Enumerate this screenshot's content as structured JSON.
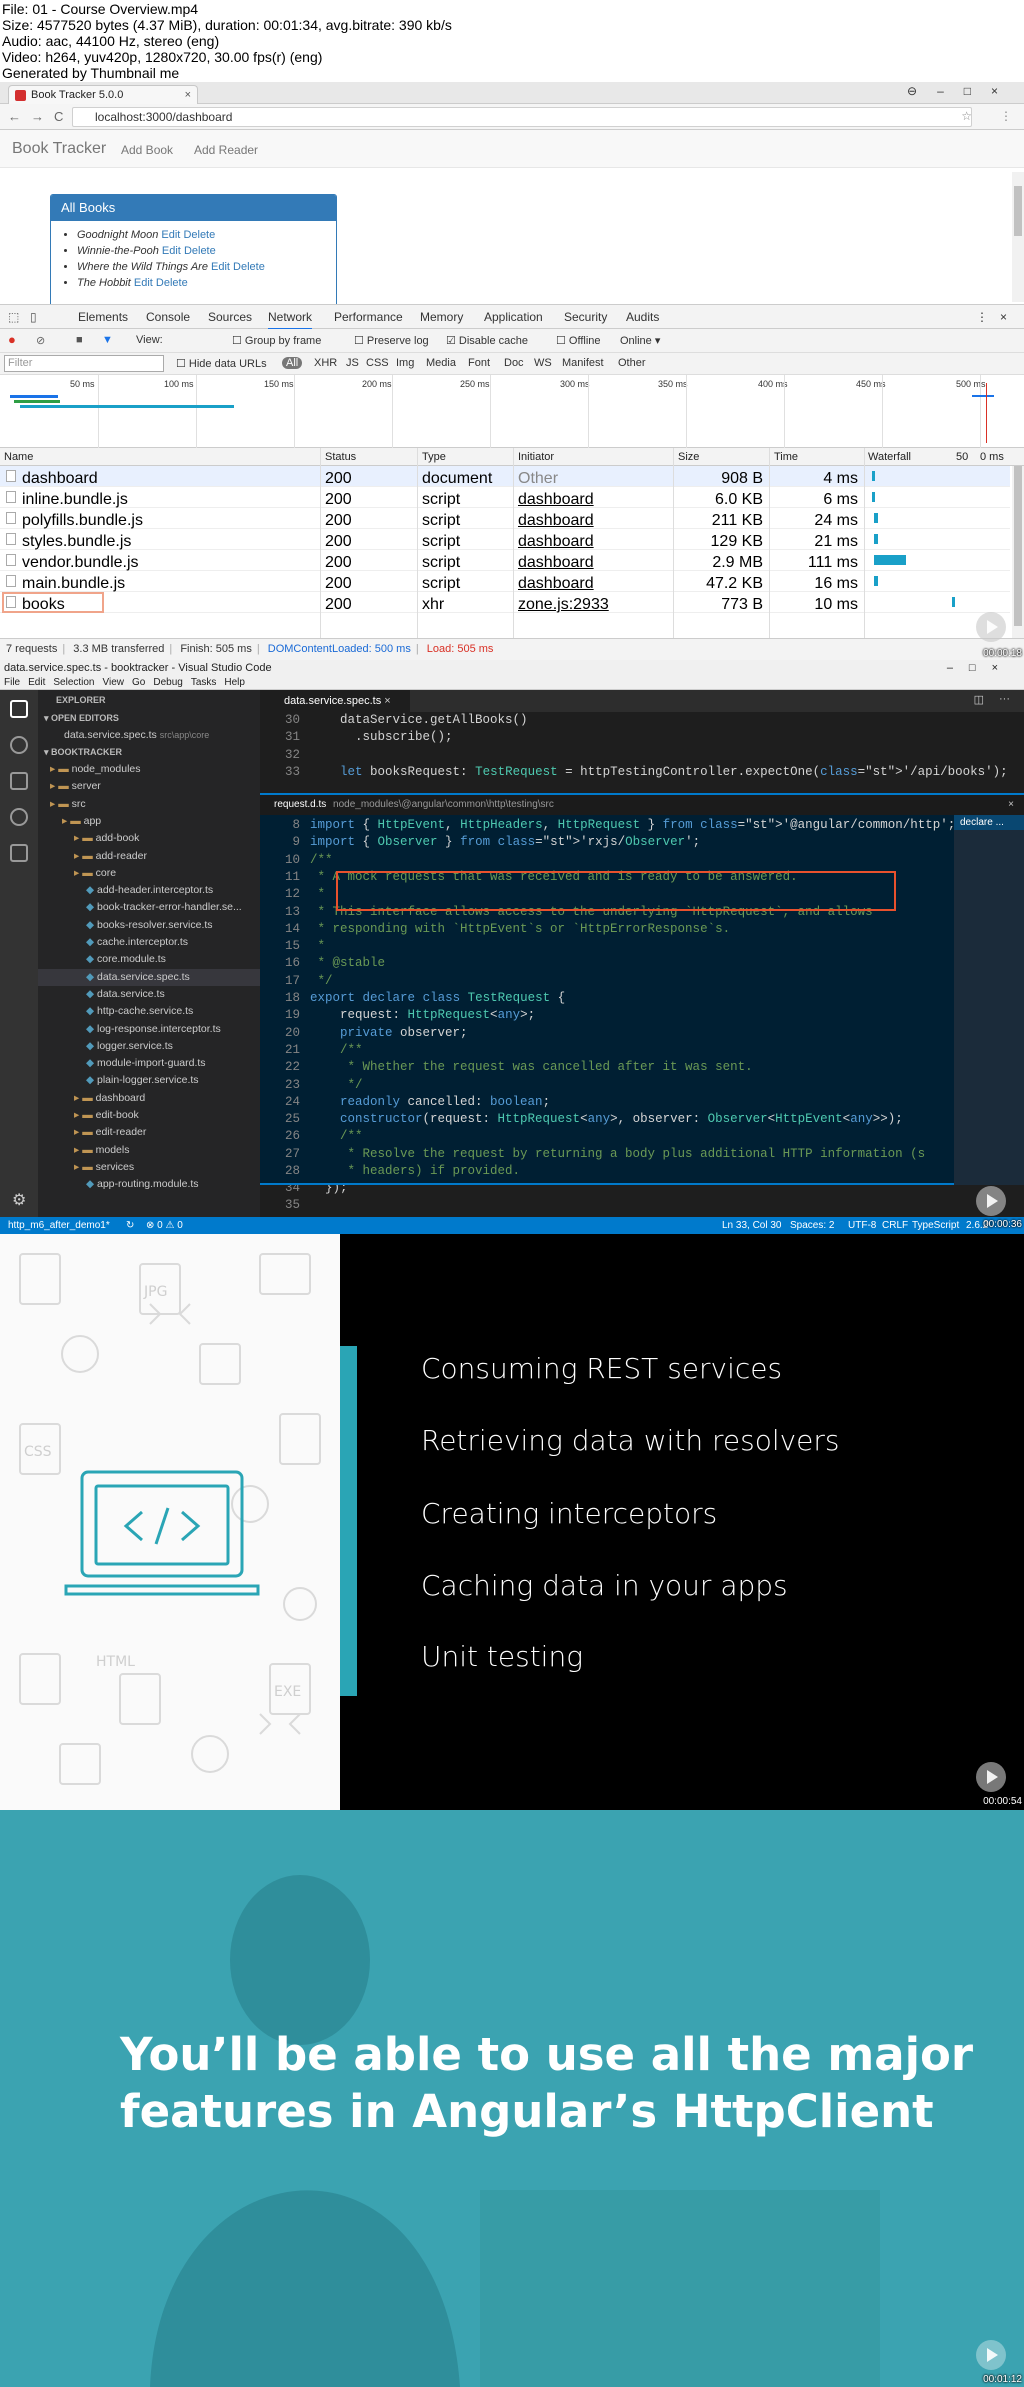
{
  "info": {
    "file": "File: 01 - Course Overview.mp4",
    "size": "Size: 4577520 bytes (4.37 MiB), duration: 00:01:34, avg.bitrate: 390 kb/s",
    "audio": "Audio: aac, 44100 Hz, stereo (eng)",
    "video": "Video: h264, yuv420p, 1280x720, 30.00 fps(r) (eng)",
    "generated": "Generated by Thumbnail me"
  },
  "frame1": {
    "tab_title": "Book Tracker 5.0.0",
    "url": "localhost:3000/dashboard",
    "brand": "Book Tracker",
    "nav_add_book": "Add Book",
    "nav_add_reader": "Add Reader",
    "panel_title": "All Books",
    "books": [
      {
        "title": "Goodnight Moon",
        "edit": "Edit",
        "del": "Delete"
      },
      {
        "title": "Winnie-the-Pooh",
        "edit": "Edit",
        "del": "Delete"
      },
      {
        "title": "Where the Wild Things Are",
        "edit": "Edit",
        "del": "Delete"
      },
      {
        "title": "The Hobbit",
        "edit": "Edit",
        "del": "Delete"
      }
    ],
    "devtools_tabs": [
      "Elements",
      "Console",
      "Sources",
      "Network",
      "Performance",
      "Memory",
      "Application",
      "Security",
      "Audits"
    ],
    "toolbar": {
      "view": "View:",
      "group": "Group by frame",
      "preserve": "Preserve log",
      "disable": "Disable cache",
      "offline": "Offline",
      "online": "Online"
    },
    "filter": {
      "placeholder": "Filter",
      "hide": "Hide data URLs",
      "types": [
        "All",
        "XHR",
        "JS",
        "CSS",
        "Img",
        "Media",
        "Font",
        "Doc",
        "WS",
        "Manifest",
        "Other"
      ]
    },
    "ticks": [
      "50 ms",
      "100 ms",
      "150 ms",
      "200 ms",
      "250 ms",
      "300 ms",
      "350 ms",
      "400 ms",
      "450 ms",
      "500 ms"
    ],
    "columns": [
      "Name",
      "Status",
      "Type",
      "Initiator",
      "Size",
      "Time",
      "Waterfall"
    ],
    "waterfall_extra": "50",
    "waterfall_extra2": "0 ms",
    "rows": [
      {
        "name": "dashboard",
        "status": "200",
        "type": "document",
        "initiator": "Other",
        "size": "908 B",
        "time": "4 ms"
      },
      {
        "name": "inline.bundle.js",
        "status": "200",
        "type": "script",
        "initiator": "dashboard",
        "size": "6.0 KB",
        "time": "6 ms"
      },
      {
        "name": "polyfills.bundle.js",
        "status": "200",
        "type": "script",
        "initiator": "dashboard",
        "size": "211 KB",
        "time": "24 ms"
      },
      {
        "name": "styles.bundle.js",
        "status": "200",
        "type": "script",
        "initiator": "dashboard",
        "size": "129 KB",
        "time": "21 ms"
      },
      {
        "name": "vendor.bundle.js",
        "status": "200",
        "type": "script",
        "initiator": "dashboard",
        "size": "2.9 MB",
        "time": "111 ms"
      },
      {
        "name": "main.bundle.js",
        "status": "200",
        "type": "script",
        "initiator": "dashboard",
        "size": "47.2 KB",
        "time": "16 ms"
      },
      {
        "name": "books",
        "status": "200",
        "type": "xhr",
        "initiator": "zone.js:2933",
        "size": "773 B",
        "time": "10 ms"
      }
    ],
    "status_bar": {
      "requests": "7 requests",
      "transferred": "3.3 MB transferred",
      "finish": "Finish: 505 ms",
      "dcl": "DOMContentLoaded: 500 ms",
      "load": "Load: 505 ms"
    },
    "timestamp": "00:00:18",
    "colors": {
      "panel": "#337ab7",
      "dcl": "#1a6ad6",
      "load": "#d93025"
    }
  },
  "frame2": {
    "title": "data.service.spec.ts - booktracker - Visual Studio Code",
    "menu": [
      "File",
      "Edit",
      "Selection",
      "View",
      "Go",
      "Debug",
      "Tasks",
      "Help"
    ],
    "explorer_title": "EXPLORER",
    "open_editors": "OPEN EDITORS",
    "open_file": "data.service.spec.ts",
    "open_file_path": "src\\app\\core",
    "project": "BOOKTRACKER",
    "tree": [
      {
        "label": "node_modules",
        "indent": 1,
        "kind": "folder"
      },
      {
        "label": "server",
        "indent": 1,
        "kind": "folder"
      },
      {
        "label": "src",
        "indent": 1,
        "kind": "folder"
      },
      {
        "label": "app",
        "indent": 2,
        "kind": "folder"
      },
      {
        "label": "add-book",
        "indent": 3,
        "kind": "folder"
      },
      {
        "label": "add-reader",
        "indent": 3,
        "kind": "folder"
      },
      {
        "label": "core",
        "indent": 3,
        "kind": "folder"
      },
      {
        "label": "add-header.interceptor.ts",
        "indent": 4,
        "kind": "file"
      },
      {
        "label": "book-tracker-error-handler.se...",
        "indent": 4,
        "kind": "file"
      },
      {
        "label": "books-resolver.service.ts",
        "indent": 4,
        "kind": "file"
      },
      {
        "label": "cache.interceptor.ts",
        "indent": 4,
        "kind": "file"
      },
      {
        "label": "core.module.ts",
        "indent": 4,
        "kind": "file"
      },
      {
        "label": "data.service.spec.ts",
        "indent": 4,
        "kind": "file"
      },
      {
        "label": "data.service.ts",
        "indent": 4,
        "kind": "file"
      },
      {
        "label": "http-cache.service.ts",
        "indent": 4,
        "kind": "file"
      },
      {
        "label": "log-response.interceptor.ts",
        "indent": 4,
        "kind": "file"
      },
      {
        "label": "logger.service.ts",
        "indent": 4,
        "kind": "file"
      },
      {
        "label": "module-import-guard.ts",
        "indent": 4,
        "kind": "file"
      },
      {
        "label": "plain-logger.service.ts",
        "indent": 4,
        "kind": "file"
      },
      {
        "label": "dashboard",
        "indent": 3,
        "kind": "folder"
      },
      {
        "label": "edit-book",
        "indent": 3,
        "kind": "folder"
      },
      {
        "label": "edit-reader",
        "indent": 3,
        "kind": "folder"
      },
      {
        "label": "models",
        "indent": 3,
        "kind": "folder"
      },
      {
        "label": "services",
        "indent": 3,
        "kind": "folder"
      },
      {
        "label": "app-routing.module.ts",
        "indent": 4,
        "kind": "file"
      }
    ],
    "tab": "data.service.spec.ts",
    "top_code": [
      {
        "n": "30",
        "t": "    dataService.getAllBooks()"
      },
      {
        "n": "31",
        "t": "      .subscribe();"
      },
      {
        "n": "32",
        "t": ""
      },
      {
        "n": "33",
        "t": "    let booksRequest: TestRequest = httpTestingController.expectOne('/api/books');"
      }
    ],
    "peek_file": "request.d.ts",
    "peek_path": "node_modules\\@angular\\common\\http\\testing\\src",
    "peek_side": "declare ...",
    "peek_code": [
      {
        "n": "8",
        "t": "import { HttpEvent, HttpHeaders, HttpRequest } from '@angular/common/http';"
      },
      {
        "n": "9",
        "t": "import { Observer } from 'rxjs/Observer';"
      },
      {
        "n": "10",
        "t": "/**"
      },
      {
        "n": "11",
        "t": " * A mock requests that was received and is ready to be answered."
      },
      {
        "n": "12",
        "t": " *"
      },
      {
        "n": "13",
        "t": " * This interface allows access to the underlying `HttpRequest`, and allows"
      },
      {
        "n": "14",
        "t": " * responding with `HttpEvent`s or `HttpErrorResponse`s."
      },
      {
        "n": "15",
        "t": " *"
      },
      {
        "n": "16",
        "t": " * @stable"
      },
      {
        "n": "17",
        "t": " */"
      },
      {
        "n": "18",
        "t": "export declare class TestRequest {"
      },
      {
        "n": "19",
        "t": "    request: HttpRequest<any>;"
      },
      {
        "n": "20",
        "t": "    private observer;"
      },
      {
        "n": "21",
        "t": "    /**"
      },
      {
        "n": "22",
        "t": "     * Whether the request was cancelled after it was sent."
      },
      {
        "n": "23",
        "t": "     */"
      },
      {
        "n": "24",
        "t": "    readonly cancelled: boolean;"
      },
      {
        "n": "25",
        "t": "    constructor(request: HttpRequest<any>, observer: Observer<HttpEvent<any>>);"
      },
      {
        "n": "26",
        "t": "    /**"
      },
      {
        "n": "27",
        "t": "     * Resolve the request by returning a body plus additional HTTP information (s"
      },
      {
        "n": "28",
        "t": "     * headers) if provided."
      }
    ],
    "bottom_code": [
      {
        "n": "34",
        "t": "  });"
      },
      {
        "n": "35",
        "t": ""
      }
    ],
    "status": {
      "branch": "http_m6_after_demo1*",
      "errors": "⊗ 0 ⚠ 0",
      "pos": "Ln 33, Col 30",
      "spaces": "Spaces: 2",
      "enc": "UTF-8",
      "eol": "CRLF",
      "lang": "TypeScript",
      "ver": "2.6.2"
    },
    "timestamp": "00:00:36"
  },
  "frame3": {
    "bullets": [
      "Consuming REST services",
      "Retrieving data with resolvers",
      "Creating interceptors",
      "Caching data in your apps",
      "Unit testing"
    ],
    "timestamp": "00:00:54",
    "pattern_labels": [
      "JPG",
      "CSS",
      "HTML",
      "EXE"
    ],
    "accent": "#2aa5b5"
  },
  "frame4": {
    "line1": "You’ll be able to use all the major",
    "line2": "features in Angular’s HttpClient",
    "timestamp": "00:01:12",
    "bg": "#3ba3b1"
  }
}
